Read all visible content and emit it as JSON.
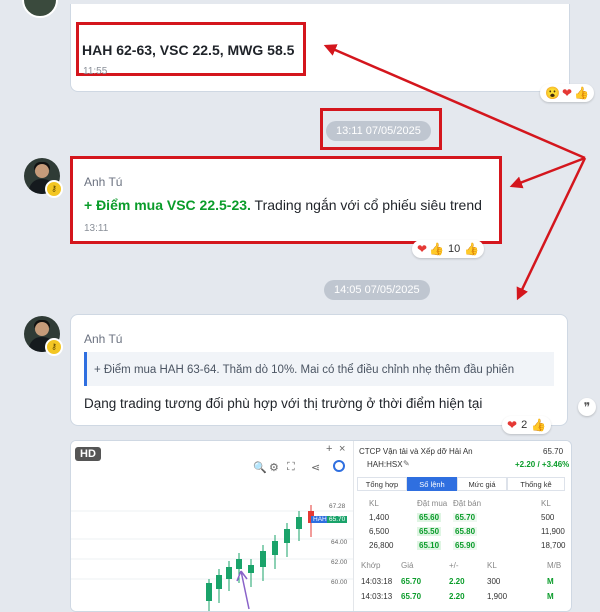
{
  "message1": {
    "text": "HAH 62-63, VSC 22.5, MWG 58.5",
    "time": "11:55",
    "reactions": [
      "😮",
      "❤",
      "👍"
    ]
  },
  "date1": "13:11 07/05/2025",
  "message2": {
    "sender": "Anh Tú",
    "highlight": "+ Điểm mua VSC 22.5-23.",
    "rest": " Trading ngắn với cổ phiếu siêu trend",
    "time": "13:11",
    "reaction_count": "10"
  },
  "date2": "14:05 07/05/2025",
  "message3": {
    "sender": "Anh Tú",
    "quote": "+ Điểm mua HAH 63-64. Thăm dò 10%. Mai có thể điều chỉnh nhẹ thêm đầu phiên",
    "text": "Dạng trading tương đối phù hợp với thị trường ở thời điểm hiện tại",
    "reaction_count": "2"
  },
  "colors": {
    "highlight_green": "#0a9c2a",
    "annotation_red": "#d4161d",
    "candle_up": "#1aa36a",
    "candle_down": "#e53935"
  },
  "chart_card": {
    "hd": "HD",
    "price_labels": [
      "67.28",
      "65.70",
      "64.00",
      "62.00",
      "60.00"
    ],
    "price_tag": "65.70",
    "hah_tag": "HAH",
    "company": "CTCP Vận tải và Xếp dỡ Hải An",
    "ticker": "HAH:HSX",
    "price": "65.70",
    "change": "+2.20 / +3.46%",
    "tabs": [
      "Tổng hợp",
      "Sổ lệnh",
      "Mức giá",
      "Thống kê"
    ],
    "book_headers": [
      "KL",
      "Đặt mua",
      "Đặt bán",
      "KL"
    ],
    "book_rows": [
      [
        "1,400",
        "65.60",
        "65.70",
        "500"
      ],
      [
        "6,500",
        "65.50",
        "65.80",
        "11,900"
      ],
      [
        "26,800",
        "65.10",
        "65.90",
        "18,700"
      ]
    ],
    "match_headers": [
      "Khớp",
      "Giá",
      "+/-",
      "KL",
      "M/B"
    ],
    "match_rows": [
      [
        "14:03:18",
        "65.70",
        "2.20",
        "300",
        "M"
      ],
      [
        "14:03:13",
        "65.70",
        "2.20",
        "1,900",
        "M"
      ]
    ]
  },
  "icons": [
    "zoom-icon",
    "settings-icon",
    "fullscreen-icon",
    "share-icon",
    "pencil-icon",
    "plus-icon",
    "close-icon",
    "reply-icon",
    "key-icon"
  ]
}
